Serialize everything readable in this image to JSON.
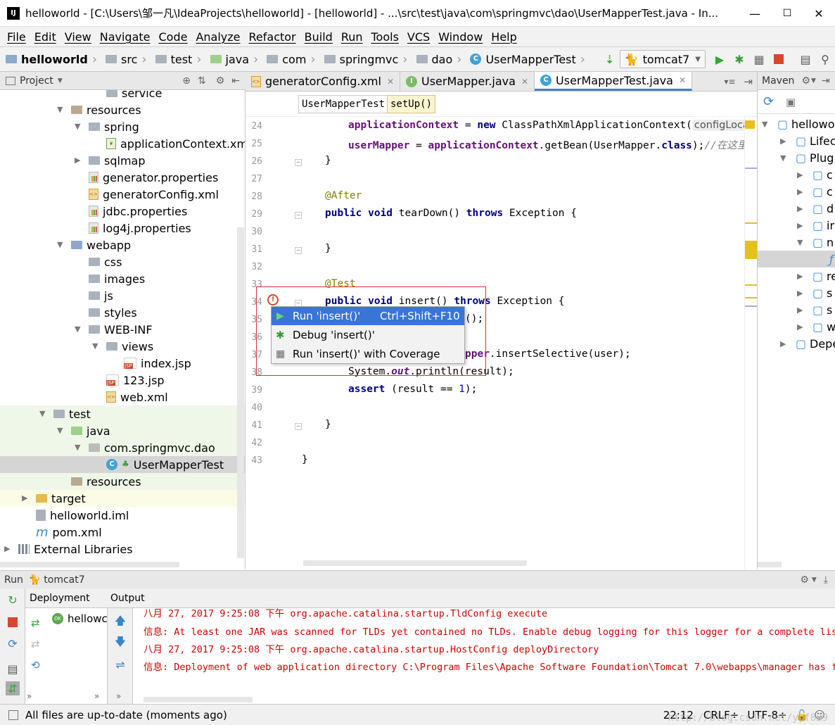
{
  "window": {
    "title": "helloworld - [C:\\Users\\邹一凡\\IdeaProjects\\helloworld] - [helloworld] - ...\\src\\test\\java\\com\\springmvc\\dao\\UserMapperTest.java - In...",
    "minimize": "—",
    "maximize": "☐",
    "close": "✕"
  },
  "menu": [
    "File",
    "Edit",
    "View",
    "Navigate",
    "Code",
    "Analyze",
    "Refactor",
    "Build",
    "Run",
    "Tools",
    "VCS",
    "Window",
    "Help"
  ],
  "navbar": {
    "crumbs": [
      "helloworld",
      "src",
      "test",
      "java",
      "com",
      "springmvc",
      "dao",
      "UserMapperTest"
    ],
    "run_config": "tomcat7"
  },
  "project_panel": {
    "title": "Project",
    "tree": [
      {
        "label": "service",
        "icon": "folder-icon",
        "depth": 6,
        "arrow": ""
      },
      {
        "label": "resources",
        "icon": "resources-folder-icon",
        "depth": 4,
        "arrow": "▼"
      },
      {
        "label": "spring",
        "icon": "folder-icon",
        "depth": 5,
        "arrow": "▼"
      },
      {
        "label": "applicationContext.xml",
        "icon": "spring-xml-icon",
        "depth": 6,
        "arrow": ""
      },
      {
        "label": "sqlmap",
        "icon": "folder-icon",
        "depth": 5,
        "arrow": "▶"
      },
      {
        "label": "generator.properties",
        "icon": "properties-icon",
        "depth": 5,
        "arrow": ""
      },
      {
        "label": "generatorConfig.xml",
        "icon": "xml-icon",
        "depth": 5,
        "arrow": ""
      },
      {
        "label": "jdbc.properties",
        "icon": "properties-icon",
        "depth": 5,
        "arrow": ""
      },
      {
        "label": "log4j.properties",
        "icon": "properties-icon",
        "depth": 5,
        "arrow": ""
      },
      {
        "label": "webapp",
        "icon": "web-folder-icon",
        "depth": 4,
        "arrow": "▼"
      },
      {
        "label": "css",
        "icon": "folder-icon",
        "depth": 5,
        "arrow": ""
      },
      {
        "label": "images",
        "icon": "folder-icon",
        "depth": 5,
        "arrow": ""
      },
      {
        "label": "js",
        "icon": "folder-icon",
        "depth": 5,
        "arrow": ""
      },
      {
        "label": "styles",
        "icon": "folder-icon",
        "depth": 5,
        "arrow": ""
      },
      {
        "label": "WEB-INF",
        "icon": "folder-icon",
        "depth": 5,
        "arrow": "▼"
      },
      {
        "label": "views",
        "icon": "folder-icon",
        "depth": 6,
        "arrow": "▼"
      },
      {
        "label": "index.jsp",
        "icon": "jsp-icon",
        "depth": 7,
        "arrow": ""
      },
      {
        "label": "123.jsp",
        "icon": "jsp-icon",
        "depth": 6,
        "arrow": ""
      },
      {
        "label": "web.xml",
        "icon": "xml-icon",
        "depth": 6,
        "arrow": ""
      },
      {
        "label": "test",
        "icon": "folder-icon",
        "depth": 3,
        "arrow": "▼"
      },
      {
        "label": "java",
        "icon": "test-source-folder-icon",
        "depth": 4,
        "arrow": "▼"
      },
      {
        "label": "com.springmvc.dao",
        "icon": "package-icon",
        "depth": 5,
        "arrow": "▼"
      },
      {
        "label": "UserMapperTest",
        "icon": "class-icon",
        "depth": 6,
        "arrow": ""
      },
      {
        "label": "resources",
        "icon": "resources-folder-icon",
        "depth": 4,
        "arrow": ""
      },
      {
        "label": "target",
        "icon": "excluded-folder-icon",
        "depth": 2,
        "arrow": "▶"
      },
      {
        "label": "helloworld.iml",
        "icon": "iml-icon",
        "depth": 2,
        "arrow": ""
      },
      {
        "label": "pom.xml",
        "icon": "maven-icon",
        "depth": 2,
        "arrow": ""
      },
      {
        "label": "External Libraries",
        "icon": "library-icon",
        "depth": 1,
        "arrow": "▶"
      }
    ]
  },
  "editor": {
    "tabs": [
      {
        "label": "generatorConfig.xml",
        "icon": "xml-icon",
        "active": false
      },
      {
        "label": "UserMapper.java",
        "icon": "interface-icon",
        "active": false
      },
      {
        "label": "UserMapperTest.java",
        "icon": "class-icon",
        "active": true
      }
    ],
    "structure_crumbs": [
      "UserMapperTest",
      "setUp()"
    ],
    "line_numbers": [
      "24",
      "25",
      "26",
      "27",
      "28",
      "29",
      "30",
      "31",
      "32",
      "33",
      "34",
      "35",
      "36",
      "37",
      "38",
      "39",
      "40",
      "41",
      "42",
      "43"
    ],
    "code": {
      "l24_field": "applicationContext",
      "l24_mid": " = ",
      "l24_new": "new",
      "l24_rest": " ClassPathXmlApplicationContext(",
      "l24_hint": "configLocation",
      "l25_field": "userMapper",
      "l25_mid": " = ",
      "l25_field2": "applicationContext",
      "l25_rest": ".getBean(UserMapper.",
      "l25_class": "class",
      "l25_end": ");",
      "l25_comment": "//在这里导",
      "l26": "}",
      "l28": "@After",
      "l29_kw": "public void",
      "l29_name": " tearDown() ",
      "l29_throws": "throws",
      "l29_exc": " Exception {",
      "l31": "}",
      "l33": "@Test",
      "l34_kw": "public void",
      "l34_name": " insert() ",
      "l34_throws": "throws",
      "l34_exc": " Exception {",
      "l35": "();",
      "l37_field": "pper",
      "l37_rest": ".insertSelective(user);",
      "l38_cls": "System.",
      "l38_out": "out",
      "l38_rest": ".println(result);",
      "l39_kw": "assert",
      "l39_rest": " (result == ",
      "l39_num": "1",
      "l39_end": ");",
      "l41": "}",
      "l43": "}"
    },
    "popup": [
      {
        "label": "Run 'insert()'",
        "shortcut": "Ctrl+Shift+F10",
        "icon": "run-icon",
        "selected": true
      },
      {
        "label": "Debug 'insert()'",
        "shortcut": "",
        "icon": "debug-icon",
        "selected": false
      },
      {
        "label": "Run 'insert()' with Coverage",
        "shortcut": "",
        "icon": "coverage-icon",
        "selected": false
      }
    ]
  },
  "maven_panel": {
    "title": "Maven",
    "items": [
      "hellowo",
      "Lifec",
      "Plug",
      "c",
      "c",
      "d",
      "ir",
      "n",
      "f",
      "re",
      "s",
      "s",
      "w",
      "Depe"
    ]
  },
  "run_panel": {
    "title": "Run",
    "config": "tomcat7",
    "deployment_label": "Deployment",
    "deployment_item": "hellowc",
    "output_label": "Output",
    "lines": [
      "八月 27, 2017 9:25:08 下午 org.apache.catalina.startup.TldConfig execute",
      "信息: At least one JAR was scanned for TLDs yet contained no TLDs. Enable debug logging for this logger for a complete list",
      "八月 27, 2017 9:25:08 下午 org.apache.catalina.startup.HostConfig deployDirectory",
      "信息: Deployment of web application directory C:\\Program Files\\Apache Software Foundation\\Tomcat 7.0\\webapps\\manager has fi"
    ]
  },
  "status_bar": {
    "message": "All files are up-to-date (moments ago)",
    "position": "22:12",
    "line_sep": "CRLF÷",
    "encoding": "UTF-8÷",
    "watermark": "http://blog.csdn.net/yyf829"
  },
  "colors": {
    "selection": "#3875d7",
    "test_bg": "#eff7e8",
    "redbox": "#e03030",
    "output_text": "#d00000"
  }
}
